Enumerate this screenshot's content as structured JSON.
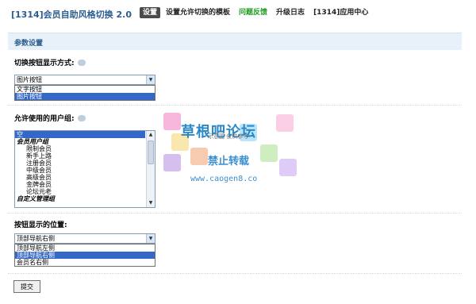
{
  "header": {
    "app_title": "[1314]会员自助风格切换 2.0",
    "nav": [
      {
        "label": "设置",
        "active": true
      },
      {
        "label": "设置允许切换的模板"
      },
      {
        "label": "问题反馈",
        "color": "#1c9a1c"
      },
      {
        "label": "升级日志"
      },
      {
        "label": "[1314]应用中心"
      }
    ]
  },
  "section_title": "参数设置",
  "switch_mode": {
    "label": "切换按钮显示方式:",
    "selected": "图片按钮",
    "options": [
      "文字按钮",
      "图片按钮"
    ]
  },
  "user_groups": {
    "label": "允许使用的用户组:",
    "options": [
      {
        "label": "空",
        "type": "selected"
      },
      {
        "label": "会员用户组",
        "type": "group"
      },
      {
        "label": "限制会员",
        "type": "item"
      },
      {
        "label": "新手上路",
        "type": "item"
      },
      {
        "label": "注册会员",
        "type": "item"
      },
      {
        "label": "中级会员",
        "type": "item"
      },
      {
        "label": "高级会员",
        "type": "item"
      },
      {
        "label": "金牌会员",
        "type": "item"
      },
      {
        "label": "论坛元老",
        "type": "item"
      },
      {
        "label": "自定义管理组",
        "type": "group"
      }
    ]
  },
  "button_position": {
    "label": "按钮显示的位置:",
    "selected": "顶部导航右侧",
    "options": [
      "顶部导航左侧",
      "顶部导航右侧",
      "会员名右侧"
    ]
  },
  "submit_label": "提交",
  "watermark": {
    "title": "草根吧论坛",
    "subtitle": "禁止转载",
    "url": "www.caogen8.co",
    "faint_text": "示意图 仅供参考"
  },
  "colors": {
    "accent": "#2b5e8f",
    "header_bg": "#e8f1fa",
    "selection": "#3468c8",
    "feedback_green": "#1c9a1c"
  }
}
